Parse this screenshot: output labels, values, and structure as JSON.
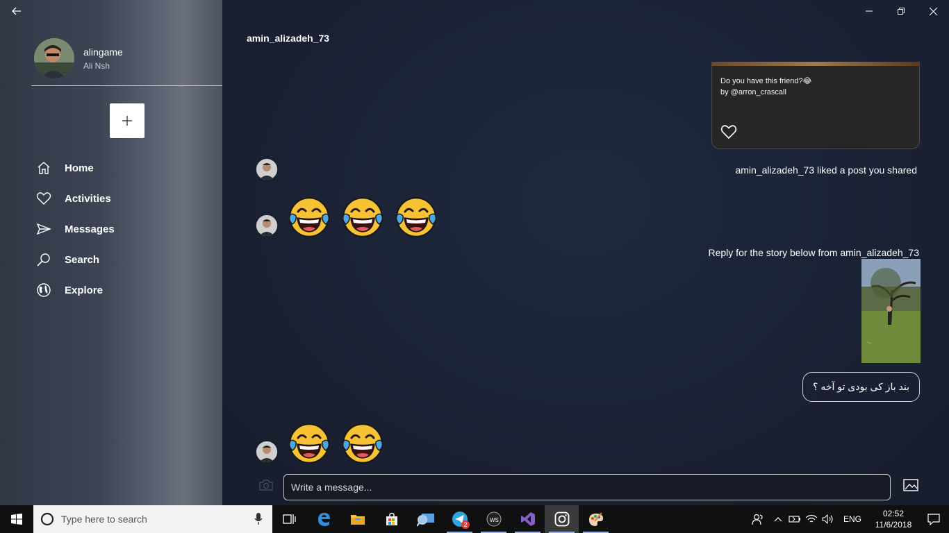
{
  "profile": {
    "username": "alingame",
    "full_name": "Ali Nsh"
  },
  "nav": [
    {
      "label": "Home",
      "icon": "home-icon"
    },
    {
      "label": "Activities",
      "icon": "heart-icon"
    },
    {
      "label": "Messages",
      "icon": "send-icon"
    },
    {
      "label": "Search",
      "icon": "search-icon"
    },
    {
      "label": "Explore",
      "icon": "globe-icon"
    }
  ],
  "chat": {
    "title": "amin_alizadeh_73",
    "shared_post_caption": "Do you have this friend?😂\nby @arron_crascall",
    "like_note": "amin_alizadeh_73 liked a post you shared",
    "story_reply_note": "Reply for the story below from amin_alizadeh_73",
    "outgoing_message": "بند باز کی بودی تو آخه ؟",
    "emoji_row_1_count": 3,
    "emoji_row_2_count": 2
  },
  "composer": {
    "placeholder": "Write a message..."
  },
  "taskbar": {
    "search_placeholder": "Type here to search",
    "telegram_badge": "2",
    "language": "ENG",
    "time": "02:52",
    "date": "11/6/2018"
  },
  "colors": {
    "sidebar": "#3d4453",
    "main_bg": "#1b2233",
    "taskbar": "#101010",
    "emoji_face": "#f7c233",
    "tear": "#4aa8e8"
  }
}
